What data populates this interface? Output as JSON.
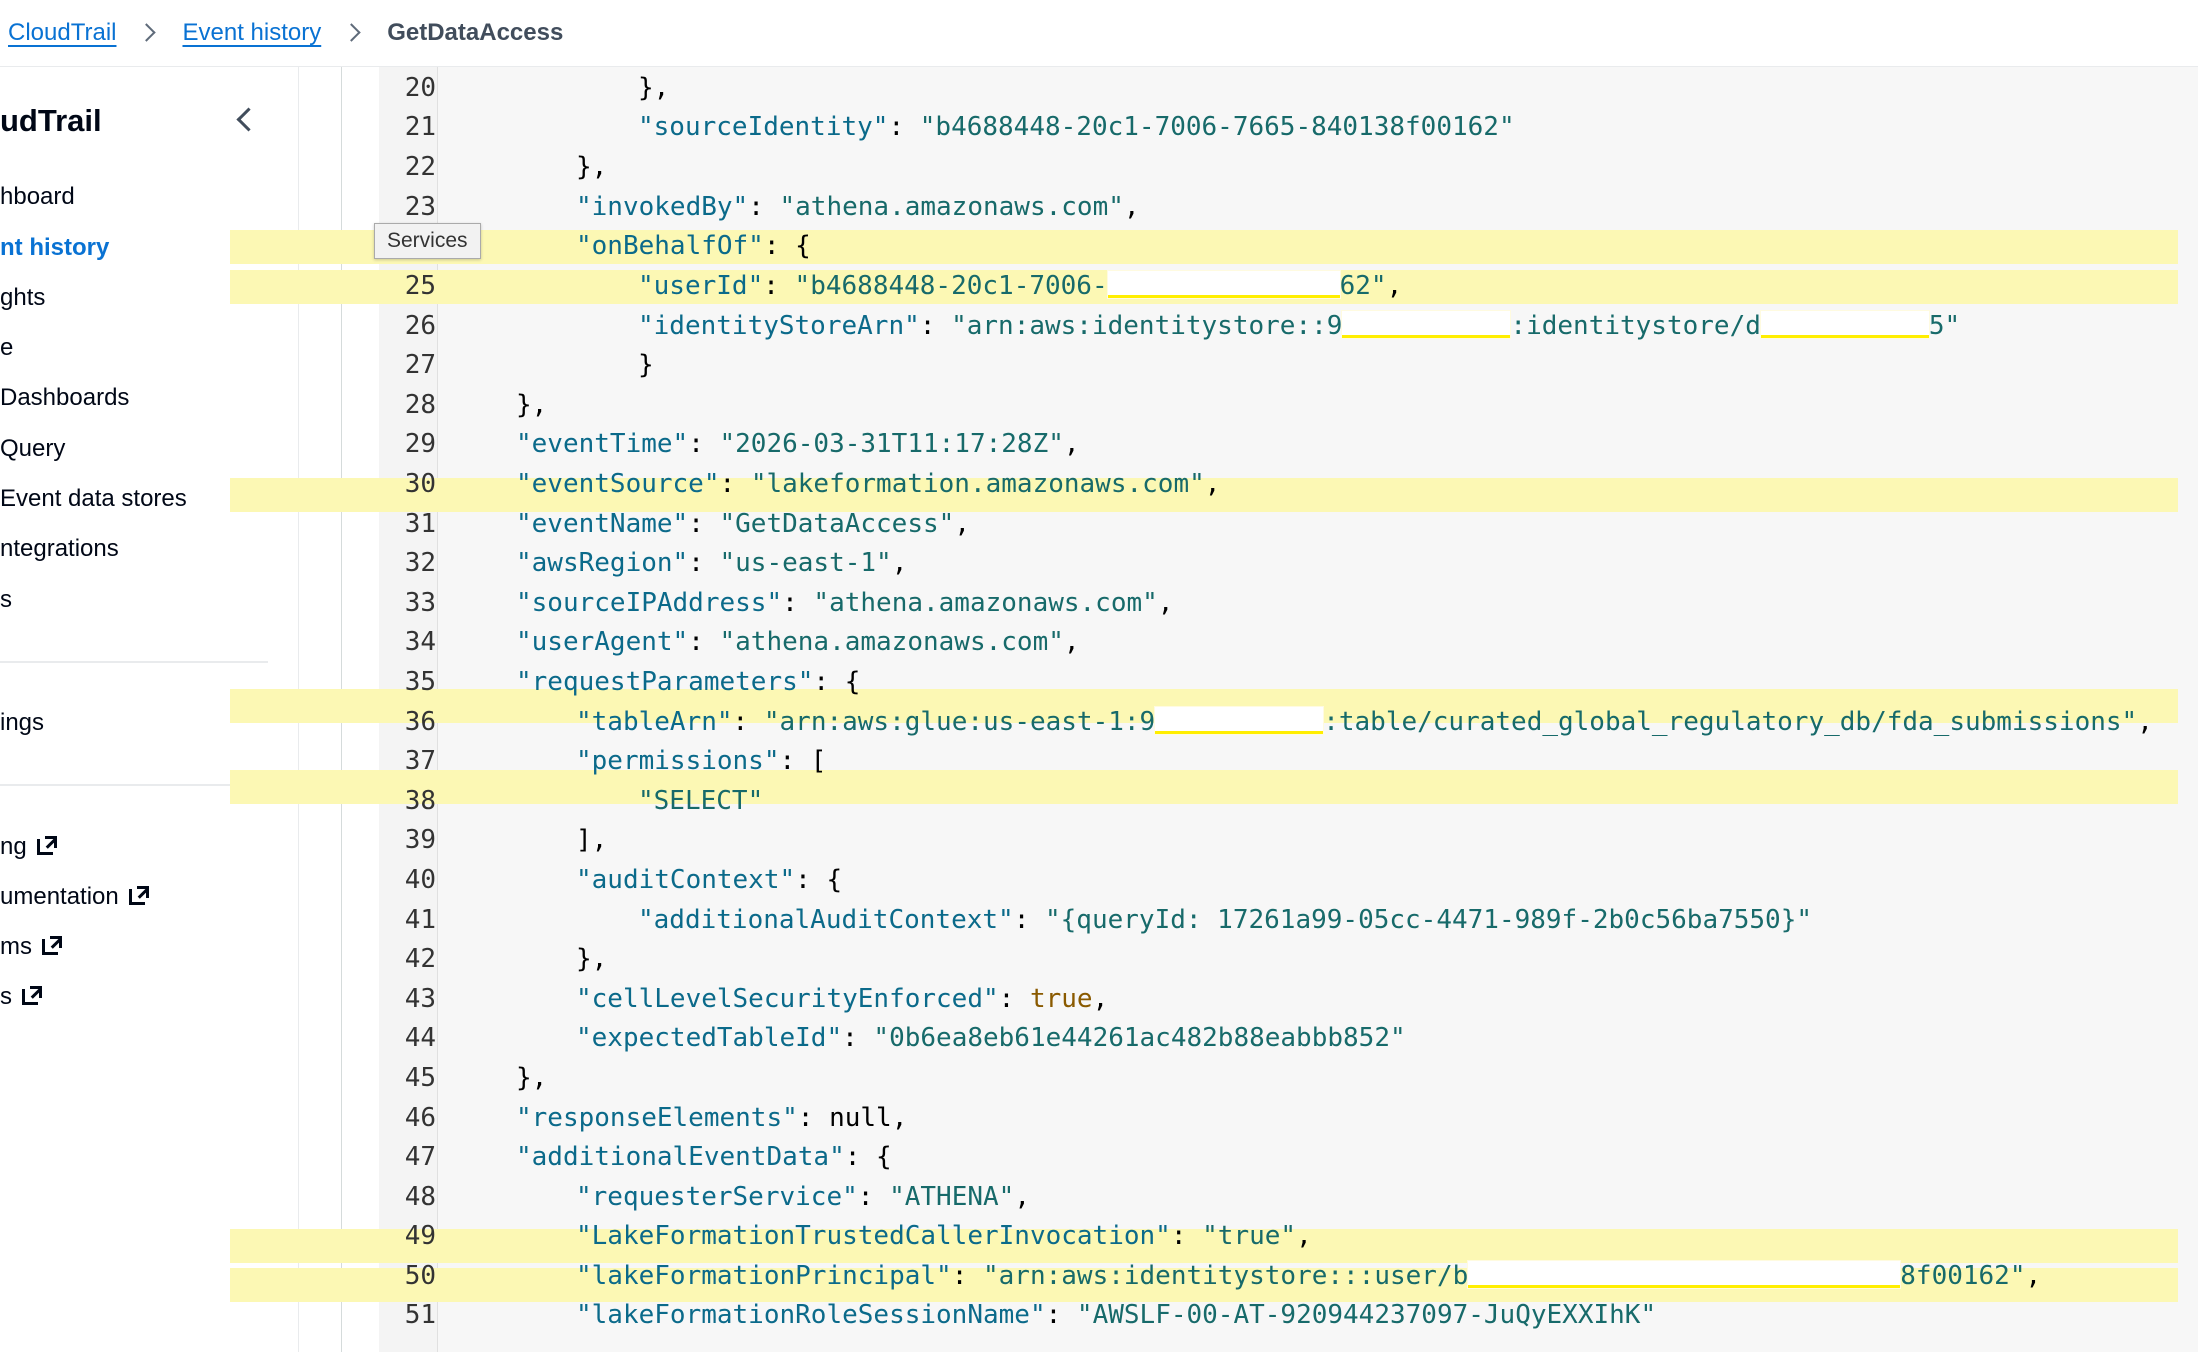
{
  "breadcrumb": {
    "items": [
      "CloudTrail",
      "Event history"
    ],
    "current": "GetDataAccess"
  },
  "sidebar": {
    "title": "udTrail",
    "items": [
      "hboard",
      "nt history",
      "ghts",
      "e",
      "Dashboards",
      "Query",
      "Event data stores",
      "ntegrations",
      "s",
      "ings",
      "ng",
      "umentation",
      "ms",
      "s"
    ]
  },
  "tooltip": "Services",
  "code": {
    "l20": {
      "n": "20",
      "t": "},"
    },
    "l21": {
      "n": "21",
      "k": "\"sourceIdentity\"",
      "v": "\"b4688448-20c1-7006-7665-840138f00162\""
    },
    "l22": {
      "n": "22",
      "t": "},"
    },
    "l23": {
      "n": "23",
      "k": "\"invokedBy\"",
      "v": "\"athena.amazonaws.com\""
    },
    "l24": {
      "k": "\"onBehalfOf\""
    },
    "l25": {
      "n": "25",
      "k": "\"userId\"",
      "v1": "\"b4688448-20c1-7006-",
      "v2": "62\""
    },
    "l26": {
      "n": "26",
      "k": "\"identityStoreArn\"",
      "v1": "\"arn:aws:identitystore::9",
      "v2": ":identitystore/d",
      "v3": "5\""
    },
    "l27": {
      "n": "27"
    },
    "l28": {
      "n": "28"
    },
    "l29": {
      "n": "29",
      "k": "\"eventTime\"",
      "v": "\"2026-03-31T11:17:28Z\""
    },
    "l30": {
      "n": "30",
      "k": "\"eventSource\"",
      "v": "\"lakeformation.amazonaws.com\""
    },
    "l31": {
      "n": "31",
      "k": "\"eventName\"",
      "v": "\"GetDataAccess\""
    },
    "l32": {
      "n": "32",
      "k": "\"awsRegion\"",
      "v": "\"us-east-1\""
    },
    "l33": {
      "n": "33",
      "k": "\"sourceIPAddress\"",
      "v": "\"athena.amazonaws.com\""
    },
    "l34": {
      "n": "34",
      "k": "\"userAgent\"",
      "v": "\"athena.amazonaws.com\""
    },
    "l35": {
      "n": "35",
      "k": "\"requestParameters\""
    },
    "l36": {
      "n": "36",
      "k": "\"tableArn\"",
      "v1": "\"arn:aws:glue:us-east-1:9",
      "v2": ":table/curated_global_regulatory_db/fda_submissions\""
    },
    "l37": {
      "n": "37",
      "k": "\"permissions\""
    },
    "l38": {
      "n": "38",
      "v": "\"SELECT\""
    },
    "l39": {
      "n": "39"
    },
    "l40": {
      "n": "40",
      "k": "\"auditContext\""
    },
    "l41": {
      "n": "41",
      "k": "\"additionalAuditContext\"",
      "v": "\"{queryId: 17261a99-05cc-4471-989f-2b0c56ba7550}\""
    },
    "l42": {
      "n": "42"
    },
    "l43": {
      "n": "43",
      "k": "\"cellLevelSecurityEnforced\"",
      "v": "true"
    },
    "l44": {
      "n": "44",
      "k": "\"expectedTableId\"",
      "v": "\"0b6ea8eb61e44261ac482b88eabbb852\""
    },
    "l45": {
      "n": "45"
    },
    "l46": {
      "n": "46",
      "k": "\"responseElements\"",
      "v": "null"
    },
    "l47": {
      "n": "47",
      "k": "\"additionalEventData\""
    },
    "l48": {
      "n": "48",
      "k": "\"requesterService\"",
      "v": "\"ATHENA\""
    },
    "l49": {
      "n": "49",
      "k": "\"LakeFormationTrustedCallerInvocation\"",
      "v": "\"true\""
    },
    "l50": {
      "n": "50",
      "k": "\"lakeFormationPrincipal\"",
      "v1": "\"arn:aws:identitystore:::user/b",
      "v2": "8f00162\""
    },
    "l51": {
      "n": "51",
      "k": "\"lakeFormationRoleSessionName\"",
      "v": "\"AWSLF-00-AT-920944237097-JuQyEXXIhK\""
    }
  }
}
